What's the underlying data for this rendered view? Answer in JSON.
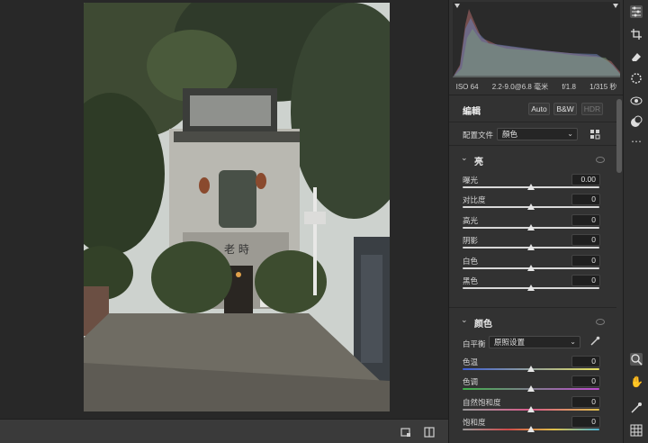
{
  "exif": {
    "iso": "ISO 64",
    "focal": "2.2-9.0@6.8 毫米",
    "aperture": "f/1.8",
    "shutter": "1/315 秒"
  },
  "edit": {
    "title": "編輯",
    "auto": "Auto",
    "bw": "B&W",
    "hdr": "HDR"
  },
  "profile": {
    "label": "配置文件",
    "value": "顏色"
  },
  "light": {
    "title": "亮",
    "sliders": [
      {
        "label": "曝光",
        "value": "0.00",
        "position": 0.5
      },
      {
        "label": "对比度",
        "value": "0",
        "position": 0.5
      },
      {
        "label": "高光",
        "value": "0",
        "position": 0.5
      },
      {
        "label": "阴影",
        "value": "0",
        "position": 0.5
      },
      {
        "label": "白色",
        "value": "0",
        "position": 0.5
      },
      {
        "label": "黑色",
        "value": "0",
        "position": 0.5
      }
    ]
  },
  "color": {
    "title": "颜色",
    "wb_label": "白平衡",
    "wb_value": "原照设置",
    "sliders": [
      {
        "label": "色温",
        "value": "0",
        "position": 0.5
      },
      {
        "label": "色调",
        "value": "0",
        "position": 0.5
      },
      {
        "label": "自然饱和度",
        "value": "0",
        "position": 0.5
      },
      {
        "label": "饱和度",
        "value": "0",
        "position": 0.5
      }
    ]
  },
  "photo": {
    "sign_text": "老 時"
  },
  "icons": {
    "toolbar": [
      "sliders-icon",
      "crop-icon",
      "eraser-icon",
      "gear-icon",
      "redeye-icon",
      "mask-icon",
      "more-icon",
      "zoom-icon",
      "hand-icon",
      "eyedropper-icon",
      "grid-icon"
    ],
    "bottom": [
      "frame-icon",
      "compare-icon"
    ]
  },
  "colors": {
    "panel": "#323232",
    "canvas": "#282828",
    "accent": "#e6e6e6"
  }
}
